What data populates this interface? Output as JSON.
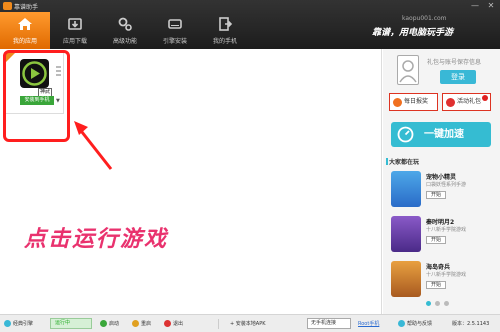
{
  "window": {
    "app_title": "靠谱助手",
    "minimize": "—",
    "close": "✕"
  },
  "nav": {
    "tabs": [
      {
        "label": "我的应用",
        "icon": "house-icon",
        "active": true
      },
      {
        "label": "应用下载",
        "icon": "download-box-icon",
        "active": false
      },
      {
        "label": "高级功能",
        "icon": "gears-icon",
        "active": false
      },
      {
        "label": "引擎安装",
        "icon": "drive-icon",
        "active": false
      },
      {
        "label": "我的手机",
        "icon": "exit-phone-icon",
        "active": false
      }
    ],
    "site_url": "kaopu001.com",
    "slogan": "靠谱，用电脑玩手游"
  },
  "main": {
    "app_tile": {
      "game_name": "神武",
      "install_label": "安装到手机",
      "dropdown_arrow": "▼",
      "icon": "play-icon"
    },
    "instruction": "点击运行游戏"
  },
  "side": {
    "login_hint": "礼包与账号保存信息",
    "login_button": "登录",
    "daily_sign": "每日报奖",
    "activity_gift": "活动礼包",
    "accelerate": "一键加速",
    "section_title": "大家都在玩",
    "games": [
      {
        "title": "宠物小精灵",
        "desc": "口袋妖怪系列手游",
        "start": "开始"
      },
      {
        "title": "秦时明月2",
        "desc": "十八新手学院游戏",
        "start": "开始"
      },
      {
        "title": "海岛奇兵",
        "desc": "十八新手学院游戏",
        "start": "开始"
      }
    ],
    "pager_dots": 3,
    "pager_active": 1
  },
  "status": {
    "engine": "经典引擎",
    "running": "运行中",
    "start": "启动",
    "restart": "重启",
    "quit": "退出",
    "install_apk": "安装本地APK",
    "no_phone": "无手机连接",
    "root": "Root手机",
    "feedback": "帮助与反馈",
    "version": "版本：2.5.1143",
    "colors": {
      "accent": "#f08a1c",
      "cyan": "#35bcd2",
      "red": "#ff1e1e",
      "pink": "#e9326e"
    }
  }
}
